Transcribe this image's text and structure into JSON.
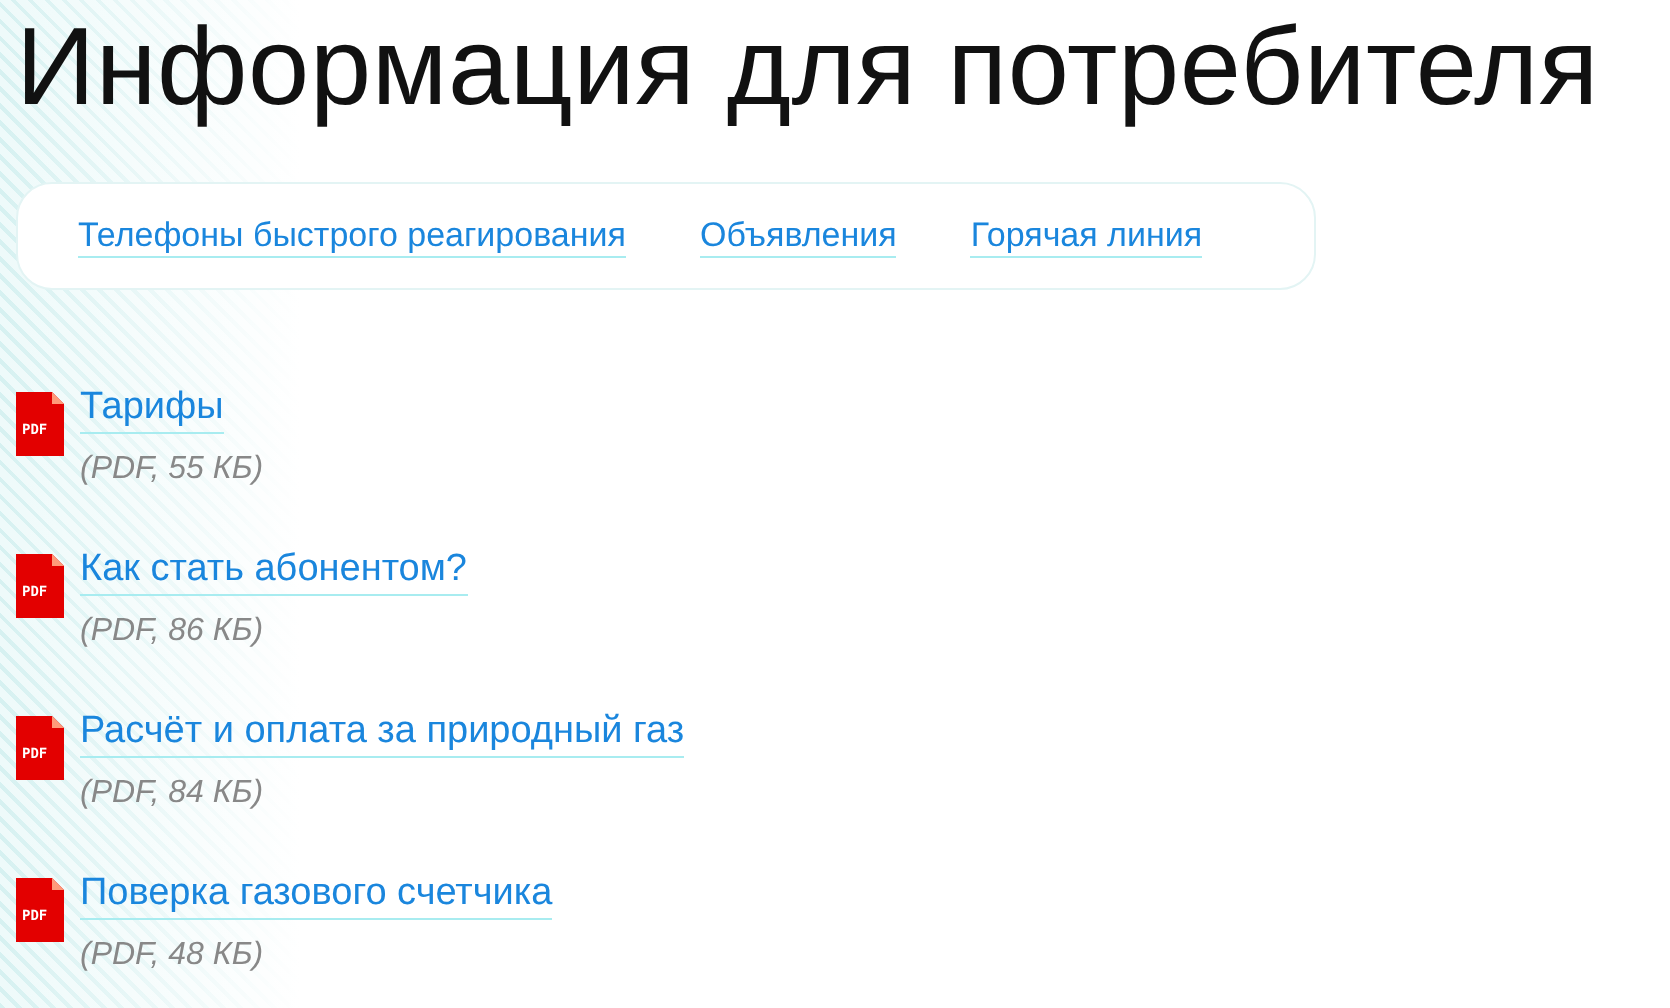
{
  "title": "Информация для потребителя",
  "nav": [
    {
      "label": "Телефоны быстрого реагирования"
    },
    {
      "label": "Объявления"
    },
    {
      "label": "Горячая линия"
    }
  ],
  "documents": [
    {
      "icon_label": "PDF",
      "title": "Тарифы",
      "meta": "(PDF, 55 КБ)"
    },
    {
      "icon_label": "PDF",
      "title": "Как стать абонентом?",
      "meta": "(PDF, 86 КБ)"
    },
    {
      "icon_label": "PDF",
      "title": "Расчёт и оплата за природный газ",
      "meta": "(PDF, 84 КБ)"
    },
    {
      "icon_label": "PDF",
      "title": "Поверка газового счетчика",
      "meta": "(PDF, 48 КБ)"
    }
  ]
}
